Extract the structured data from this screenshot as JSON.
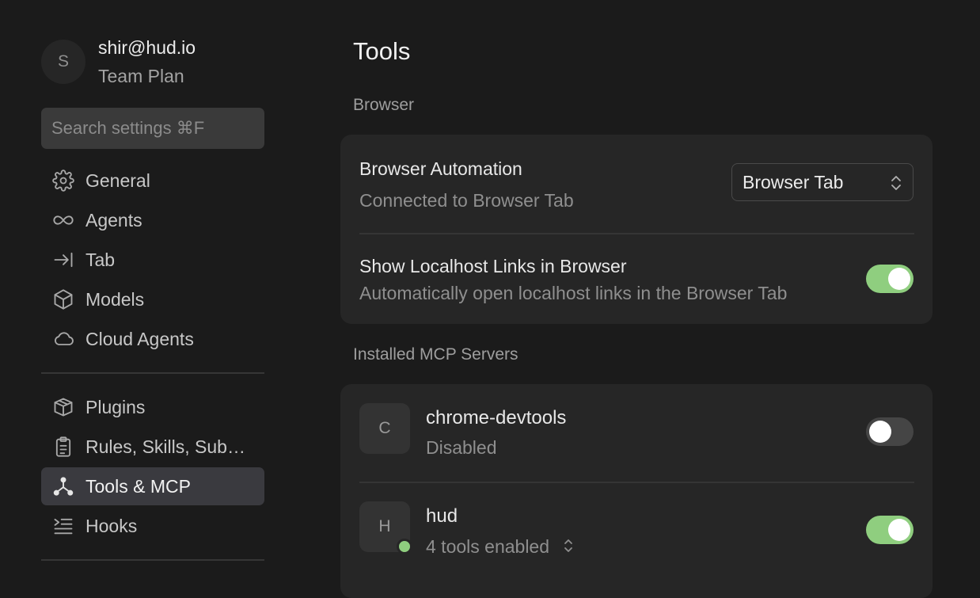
{
  "account": {
    "initial": "S",
    "email": "shir@hud.io",
    "plan": "Team Plan"
  },
  "search": {
    "placeholder": "Search settings ⌘F"
  },
  "sidebar": {
    "items": [
      {
        "label": "General",
        "icon": "gear-icon"
      },
      {
        "label": "Agents",
        "icon": "infinity-icon"
      },
      {
        "label": "Tab",
        "icon": "tab-arrow-icon"
      },
      {
        "label": "Models",
        "icon": "cube-icon"
      },
      {
        "label": "Cloud Agents",
        "icon": "cloud-icon"
      },
      {
        "label": "Plugins",
        "icon": "package-icon"
      },
      {
        "label": "Rules, Skills, Sub…",
        "icon": "clipboard-icon"
      },
      {
        "label": "Tools & MCP",
        "icon": "nodes-icon",
        "active": true
      },
      {
        "label": "Hooks",
        "icon": "list-indent-icon"
      }
    ]
  },
  "page": {
    "title": "Tools"
  },
  "browser": {
    "section_label": "Browser",
    "automation": {
      "title": "Browser Automation",
      "subtitle": "Connected to Browser Tab",
      "select_value": "Browser Tab"
    },
    "localhost": {
      "title": "Show Localhost Links in Browser",
      "subtitle": "Automatically open localhost links in the Browser Tab",
      "enabled": true
    }
  },
  "mcp": {
    "section_label": "Installed MCP Servers",
    "servers": [
      {
        "initial": "C",
        "name": "chrome-devtools",
        "status": "Disabled",
        "enabled": false
      },
      {
        "initial": "H",
        "name": "hud",
        "status": "4 tools enabled",
        "enabled": true
      }
    ]
  },
  "colors": {
    "accent_green": "#8fce7f",
    "background": "#1b1b1b",
    "card": "#262626",
    "active_item": "#3a3a3f"
  }
}
